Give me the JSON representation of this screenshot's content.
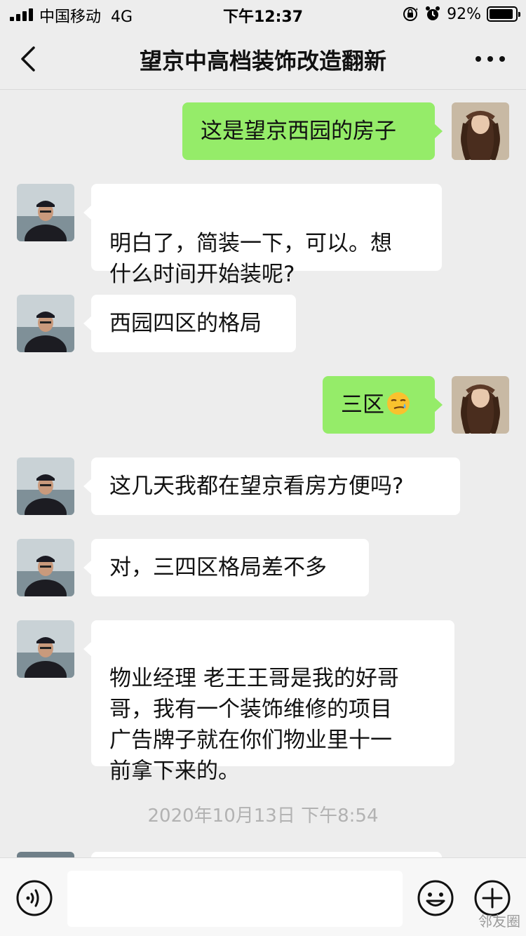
{
  "status_bar": {
    "carrier": "中国移动",
    "network": "4G",
    "time": "下午12:37",
    "battery": "92%",
    "battery_level": 0.92,
    "icons": [
      "signal-icon",
      "rotation-lock-icon",
      "alarm-icon",
      "battery-icon"
    ]
  },
  "nav": {
    "title": "望京中高档装饰改造翻新",
    "back_icon": "back-chevron-icon",
    "more_icon": "more-dots-icon"
  },
  "messages": [
    {
      "side": "right",
      "text": "这是望京西园的房子"
    },
    {
      "side": "left",
      "text": "明白了，简装一下，可以。想\n什么时间开始装呢?"
    },
    {
      "side": "left",
      "text": "西园四区的格局"
    },
    {
      "side": "right",
      "text": "三区",
      "emoji": "smirk-face-emoji"
    },
    {
      "side": "left",
      "text": "这几天我都在望京看房方便吗?"
    },
    {
      "side": "left",
      "text": "对，三四区格局差不多"
    },
    {
      "side": "left",
      "text": "物业经理  老王王哥是我的好哥\n哥，我有一个装饰维修的项目\n广告牌子就在你们物业里十一\n前拿下来的。"
    }
  ],
  "timestamp": "2020年10月13日 下午8:54",
  "input_bar": {
    "placeholder": "",
    "voice_icon": "voice-icon",
    "emoji_icon": "emoji-icon",
    "plus_icon": "plus-icon"
  },
  "watermark": "邻友圈",
  "colors": {
    "background": "#ededed",
    "bubble_self": "#95ec69",
    "bubble_other": "#ffffff",
    "timestamp": "#b2b2b2"
  }
}
